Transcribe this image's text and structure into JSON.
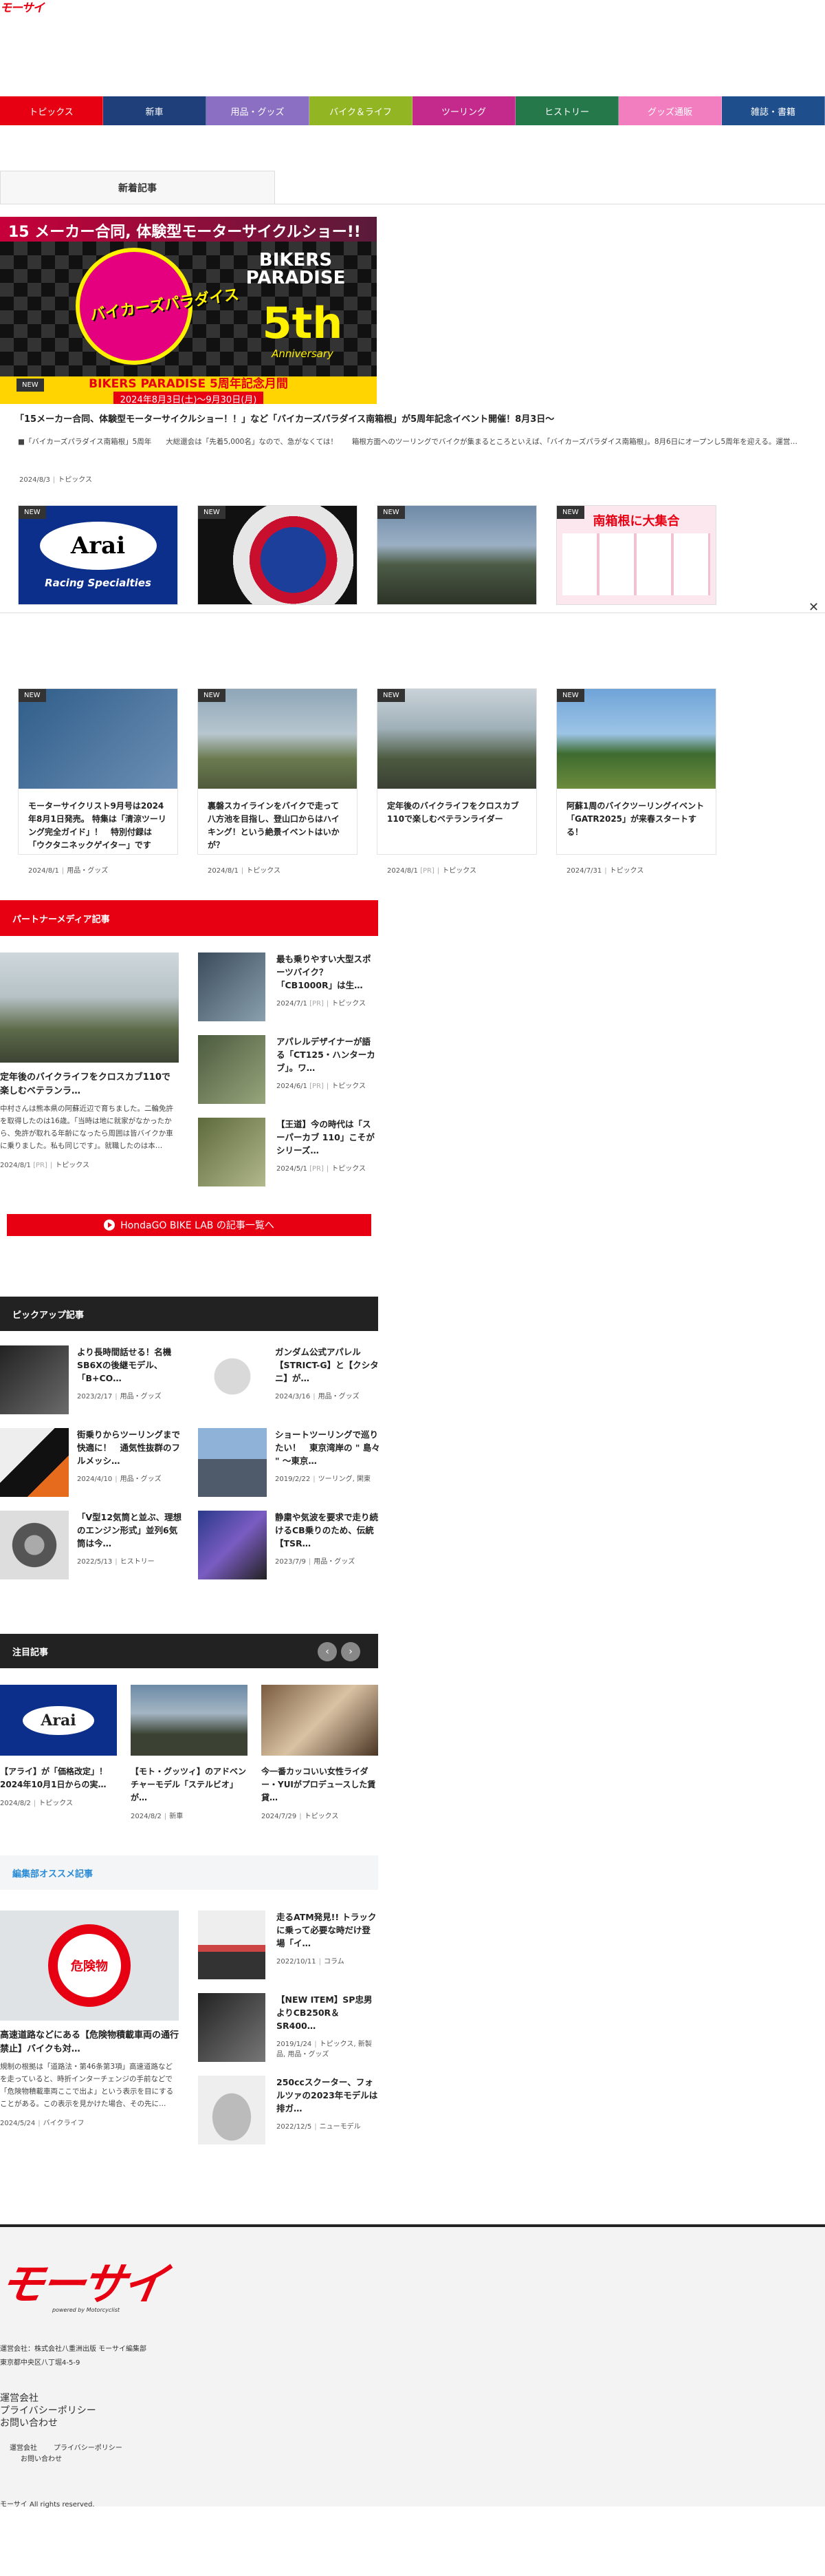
{
  "brand": {
    "logo": "モーサイ",
    "footer_logo": "モーサイ",
    "footer_powered": "powered by Motorcyclist"
  },
  "nav": [
    {
      "label": "トピックス",
      "color": "#e60012"
    },
    {
      "label": "新車",
      "color": "#1e3f7a"
    },
    {
      "label": "用品・グッズ",
      "color": "#8a6fc2"
    },
    {
      "label": "バイク＆ライフ",
      "color": "#92b523"
    },
    {
      "label": "ツーリング",
      "color": "#c42a8c"
    },
    {
      "label": "ヒストリー",
      "color": "#25784a"
    },
    {
      "label": "グッズ通販",
      "color": "#f27ec0"
    },
    {
      "label": "雑誌・書籍",
      "color": "#1f4e8c"
    }
  ],
  "latest": {
    "tab": "新着記事",
    "hero": {
      "headline": "15 メーカー合同, 体験型モーターサイクルショー!!",
      "brand_line1": "BIKERS",
      "brand_line2": "PARADISE",
      "brand_5th": "5th",
      "brand_anniv": "Anniversary",
      "logo_jp": "バイカーズパラダイス",
      "banner1": "BIKERS PARADISE 5周年記念月間",
      "banner2": "2024年8月3日(土)〜9月30日(月)",
      "new_tag": "NEW",
      "caption": "「15メーカー合同、体験型モーターサイクルショー！！」など「バイカーズパラダイス南箱根」が5周年記念イベント開催！8月3日〜",
      "excerpt": "■「バイカーズパラダイス南箱根」5周年　　大総還会は「先着5,000名」なので、急がなくては！　　箱根方面へのツーリングでバイクが集まるところといえば、「バイカーズパラダイス南箱根」。8月6日にオープンし5周年を迎える。運営…",
      "date": "2024/8/3",
      "category": "トピックス"
    },
    "thumbs": [
      {
        "new": "NEW",
        "label": "Arai",
        "sub": "Racing Specialties"
      },
      {
        "new": "NEW",
        "label": ""
      },
      {
        "new": "NEW",
        "label": ""
      },
      {
        "new": "NEW",
        "label": "南箱根に大集合"
      }
    ],
    "close": "✕",
    "cards": [
      {
        "new": "NEW",
        "title": "モーターサイクリスト9月号は2024年8月1日発売。 特集は「清涼ツーリング完全ガイド」！　特別付録は「ウクタニネックゲイター」です",
        "date": "2024/8/1",
        "pr": "",
        "category": "用品・グッズ"
      },
      {
        "new": "NEW",
        "title": "裏磐スカイラインをバイクで走って八方池を目指し、登山口からはハイキング！という絶景イベントはいかが？",
        "date": "2024/8/1",
        "pr": "",
        "category": "トピックス"
      },
      {
        "new": "NEW",
        "title": "定年後のバイクライフをクロスカブ110で楽しむベテランライダー",
        "date": "2024/8/1",
        "pr": "[PR]",
        "category": "トピックス"
      },
      {
        "new": "NEW",
        "title": "阿蘇1周のバイクツーリングイベント「GATR2025」が来春スタートする！",
        "date": "2024/7/31",
        "pr": "",
        "category": "トピックス"
      }
    ]
  },
  "partner": {
    "heading": "パートナーメディア記事",
    "big": {
      "title": "定年後のバイクライフをクロスカブ110で楽しむベテランラ…",
      "excerpt": "中村さんは熊本県の阿蘇近辺で育ちました。二輪免許を取得したのは16歳。「当時は地に就家がなかったから、免許が取れる年齢になったら周囲は皆バイクか車に乗りました。私も同じです」。就職したのは本…",
      "date": "2024/8/1",
      "pr": "[PR]",
      "category": "トピックス"
    },
    "small": [
      {
        "title": "最も乗りやすい大型スポーツバイク？「CB1000R」は生…",
        "date": "2024/7/1",
        "pr": "[PR]",
        "category": "トピックス"
      },
      {
        "title": "アパレルデザイナーが語る「CT125・ハンターカブ」。ワ…",
        "date": "2024/6/1",
        "pr": "[PR]",
        "category": "トピックス"
      },
      {
        "title": "【王道】今の時代は「スーパーカブ 110」こそがシリーズ…",
        "date": "2024/5/1",
        "pr": "[PR]",
        "category": "トピックス"
      }
    ],
    "button": "HondaGO BIKE LAB の記事一覧へ"
  },
  "pickup": {
    "heading": "ピックアップ記事",
    "items": [
      {
        "title": "より長時間話せる！名機SB6Xの後継モデル、「B+CO…",
        "date": "2023/2/17",
        "category": "用品・グッズ"
      },
      {
        "title": "ガンダム公式アパレル【STRICT-G】と【クシタニ】が…",
        "date": "2024/3/16",
        "category": "用品・グッズ"
      },
      {
        "title": "街乗りからツーリングまで快適に！　通気性抜群のフルメッシ…",
        "date": "2024/4/10",
        "category": "用品・グッズ"
      },
      {
        "title": "ショートツーリングで巡りたい！　東京湾岸の \" 島々 \" ～東京…",
        "date": "2019/2/22",
        "category": "ツーリング, 閑東"
      },
      {
        "title": "「V型12気筒と並ぶ、理想のエンジン形式」並列6気筒は今…",
        "date": "2022/5/13",
        "category": "ヒストリー"
      },
      {
        "title": "静粛や気波を要求で走り続けるCB乗りのため、伝統【TSR…",
        "date": "2023/7/9",
        "category": "用品・グッズ"
      }
    ]
  },
  "attention": {
    "heading": "注目記事",
    "prev": "‹",
    "next": "›",
    "items": [
      {
        "title": "【アライ】が「価格改定」！　2024年10月1日からの実…",
        "date": "2024/8/2",
        "category": "トピックス"
      },
      {
        "title": "【モト・グッツィ】のアドベンチャーモデル「ステルビオ」が…",
        "date": "2024/8/2",
        "category": "新車"
      },
      {
        "title": "今一番カッコいい女性ライダー・YUIがプロデュースした賃貸…",
        "date": "2024/7/29",
        "category": "トピックス"
      }
    ]
  },
  "editors": {
    "heading": "編集部オススメ記事",
    "big": {
      "sign": "危険物",
      "title": "高速道路などにある【危険物積載車両の通行禁止】バイクも対…",
      "excerpt": "規制の根拠は「道路法・第46条第3項」高速道路などを走っていると、時折インターチェンジの手前などで「危険物積載車両ここで出よ」という表示を目にすることがある。この表示を見かけた場合、その先に…",
      "date": "2024/5/24",
      "category": "バイクライフ"
    },
    "small": [
      {
        "title": "走るATM発見!! トラックに乗って必要な時だけ登場「イ…",
        "date": "2022/10/11",
        "category": "コラム"
      },
      {
        "title": "【NEW ITEM】SP忠男よりCB250R＆SR400…",
        "date": "2019/1/24",
        "category": "トピックス, 新製品, 用品・グッズ"
      },
      {
        "title": "250ccスクーター、フォルツァの2023年モデルは排ガ…",
        "date": "2022/12/5",
        "category": "ニューモデル"
      }
    ]
  },
  "footer": {
    "company": "運営会社：株式会社八重洲出版 モーサイ編集部",
    "address": "東京都中央区八丁堀4-5-9",
    "links": [
      "運営会社",
      "プライバシーポリシー",
      "お問い合わせ"
    ],
    "small_links": [
      "運営会社",
      "プライバシーポリシー",
      "お問い合わせ"
    ],
    "copyright": "モーサイ All rights reserved."
  }
}
